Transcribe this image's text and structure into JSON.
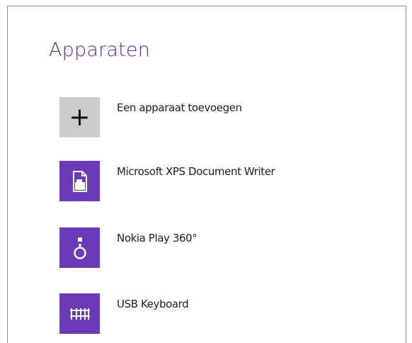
{
  "header": {
    "title": "Apparaten"
  },
  "devices": [
    {
      "label": "Een apparaat toevoegen",
      "icon": "plus-icon"
    },
    {
      "label": "Microsoft XPS Document Writer",
      "icon": "document-writer-icon"
    },
    {
      "label": "Nokia Play 360°",
      "icon": "speaker-icon"
    },
    {
      "label": "USB Keyboard",
      "icon": "keyboard-icon"
    }
  ],
  "colors": {
    "accent": "#6a3ab7",
    "title": "#5a2ea6",
    "add_tile": "#cccccc"
  }
}
